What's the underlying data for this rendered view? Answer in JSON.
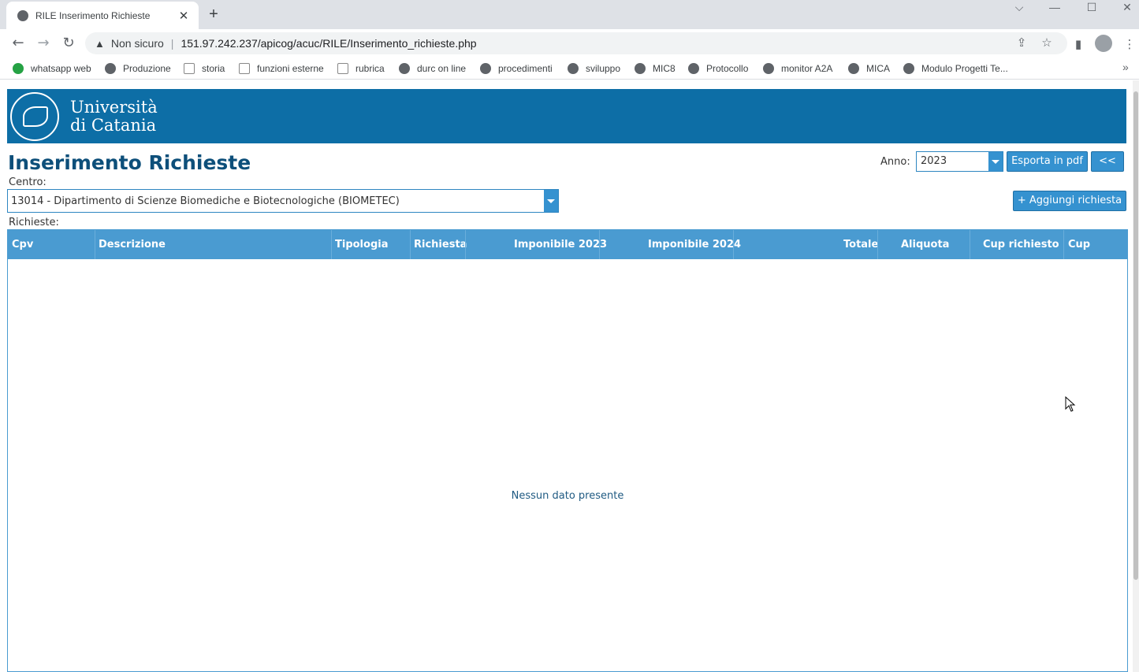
{
  "browser": {
    "tab_title": "RILE Inserimento Richieste",
    "tab_close": "✕",
    "new_tab": "+",
    "window_controls": [
      "⌵",
      "—",
      "☐",
      "✕"
    ],
    "omnibox": {
      "warning_icon": "▲",
      "insecure_label": "Non sicuro",
      "separator": "|",
      "url": "151.97.242.237/apicog/acuc/RILE/Inserimento_richieste.php"
    },
    "bookmarks": [
      {
        "label": "whatsapp web",
        "icon": "whatsapp-icon"
      },
      {
        "label": "Produzione",
        "icon": "globe-icon"
      },
      {
        "label": "storia",
        "icon": "image-icon"
      },
      {
        "label": "funzioni esterne",
        "icon": "image-icon"
      },
      {
        "label": "rubrica",
        "icon": "image-icon"
      },
      {
        "label": "durc on line",
        "icon": "globe-icon"
      },
      {
        "label": "procedimenti",
        "icon": "globe-icon"
      },
      {
        "label": "sviluppo",
        "icon": "globe-icon"
      },
      {
        "label": "MIC8",
        "icon": "globe-icon"
      },
      {
        "label": "Protocollo",
        "icon": "globe-icon"
      },
      {
        "label": "monitor A2A",
        "icon": "globe-icon"
      },
      {
        "label": "MICA",
        "icon": "globe-icon"
      },
      {
        "label": "Modulo Progetti Te...",
        "icon": "globe-icon"
      }
    ],
    "bookmarks_more": "»"
  },
  "banner": {
    "university_line1": "Università",
    "university_line2": "di Catania",
    "accent": "#0d6ea6"
  },
  "page": {
    "title": "Inserimento Richieste",
    "anno_label": "Anno:",
    "anno_value": "2023",
    "export_pdf": "Esporta in pdf",
    "back": "<<",
    "centro_label": "Centro:",
    "centro_value": "13014 - Dipartimento di Scienze Biomediche e Biotecnologiche (BIOMETEC)",
    "add_request": "+ Aggiungi richiesta",
    "richieste_label": "Richieste:"
  },
  "grid": {
    "columns": [
      "Cpv",
      "Descrizione",
      "Tipologia",
      "Richiesta",
      "Imponibile 2023",
      "Imponibile 2024",
      "Totale",
      "Aliquota",
      "Cup richiesto",
      "Cup"
    ],
    "empty_message": "Nessun dato presente",
    "header_color": "#4a9bd1"
  }
}
